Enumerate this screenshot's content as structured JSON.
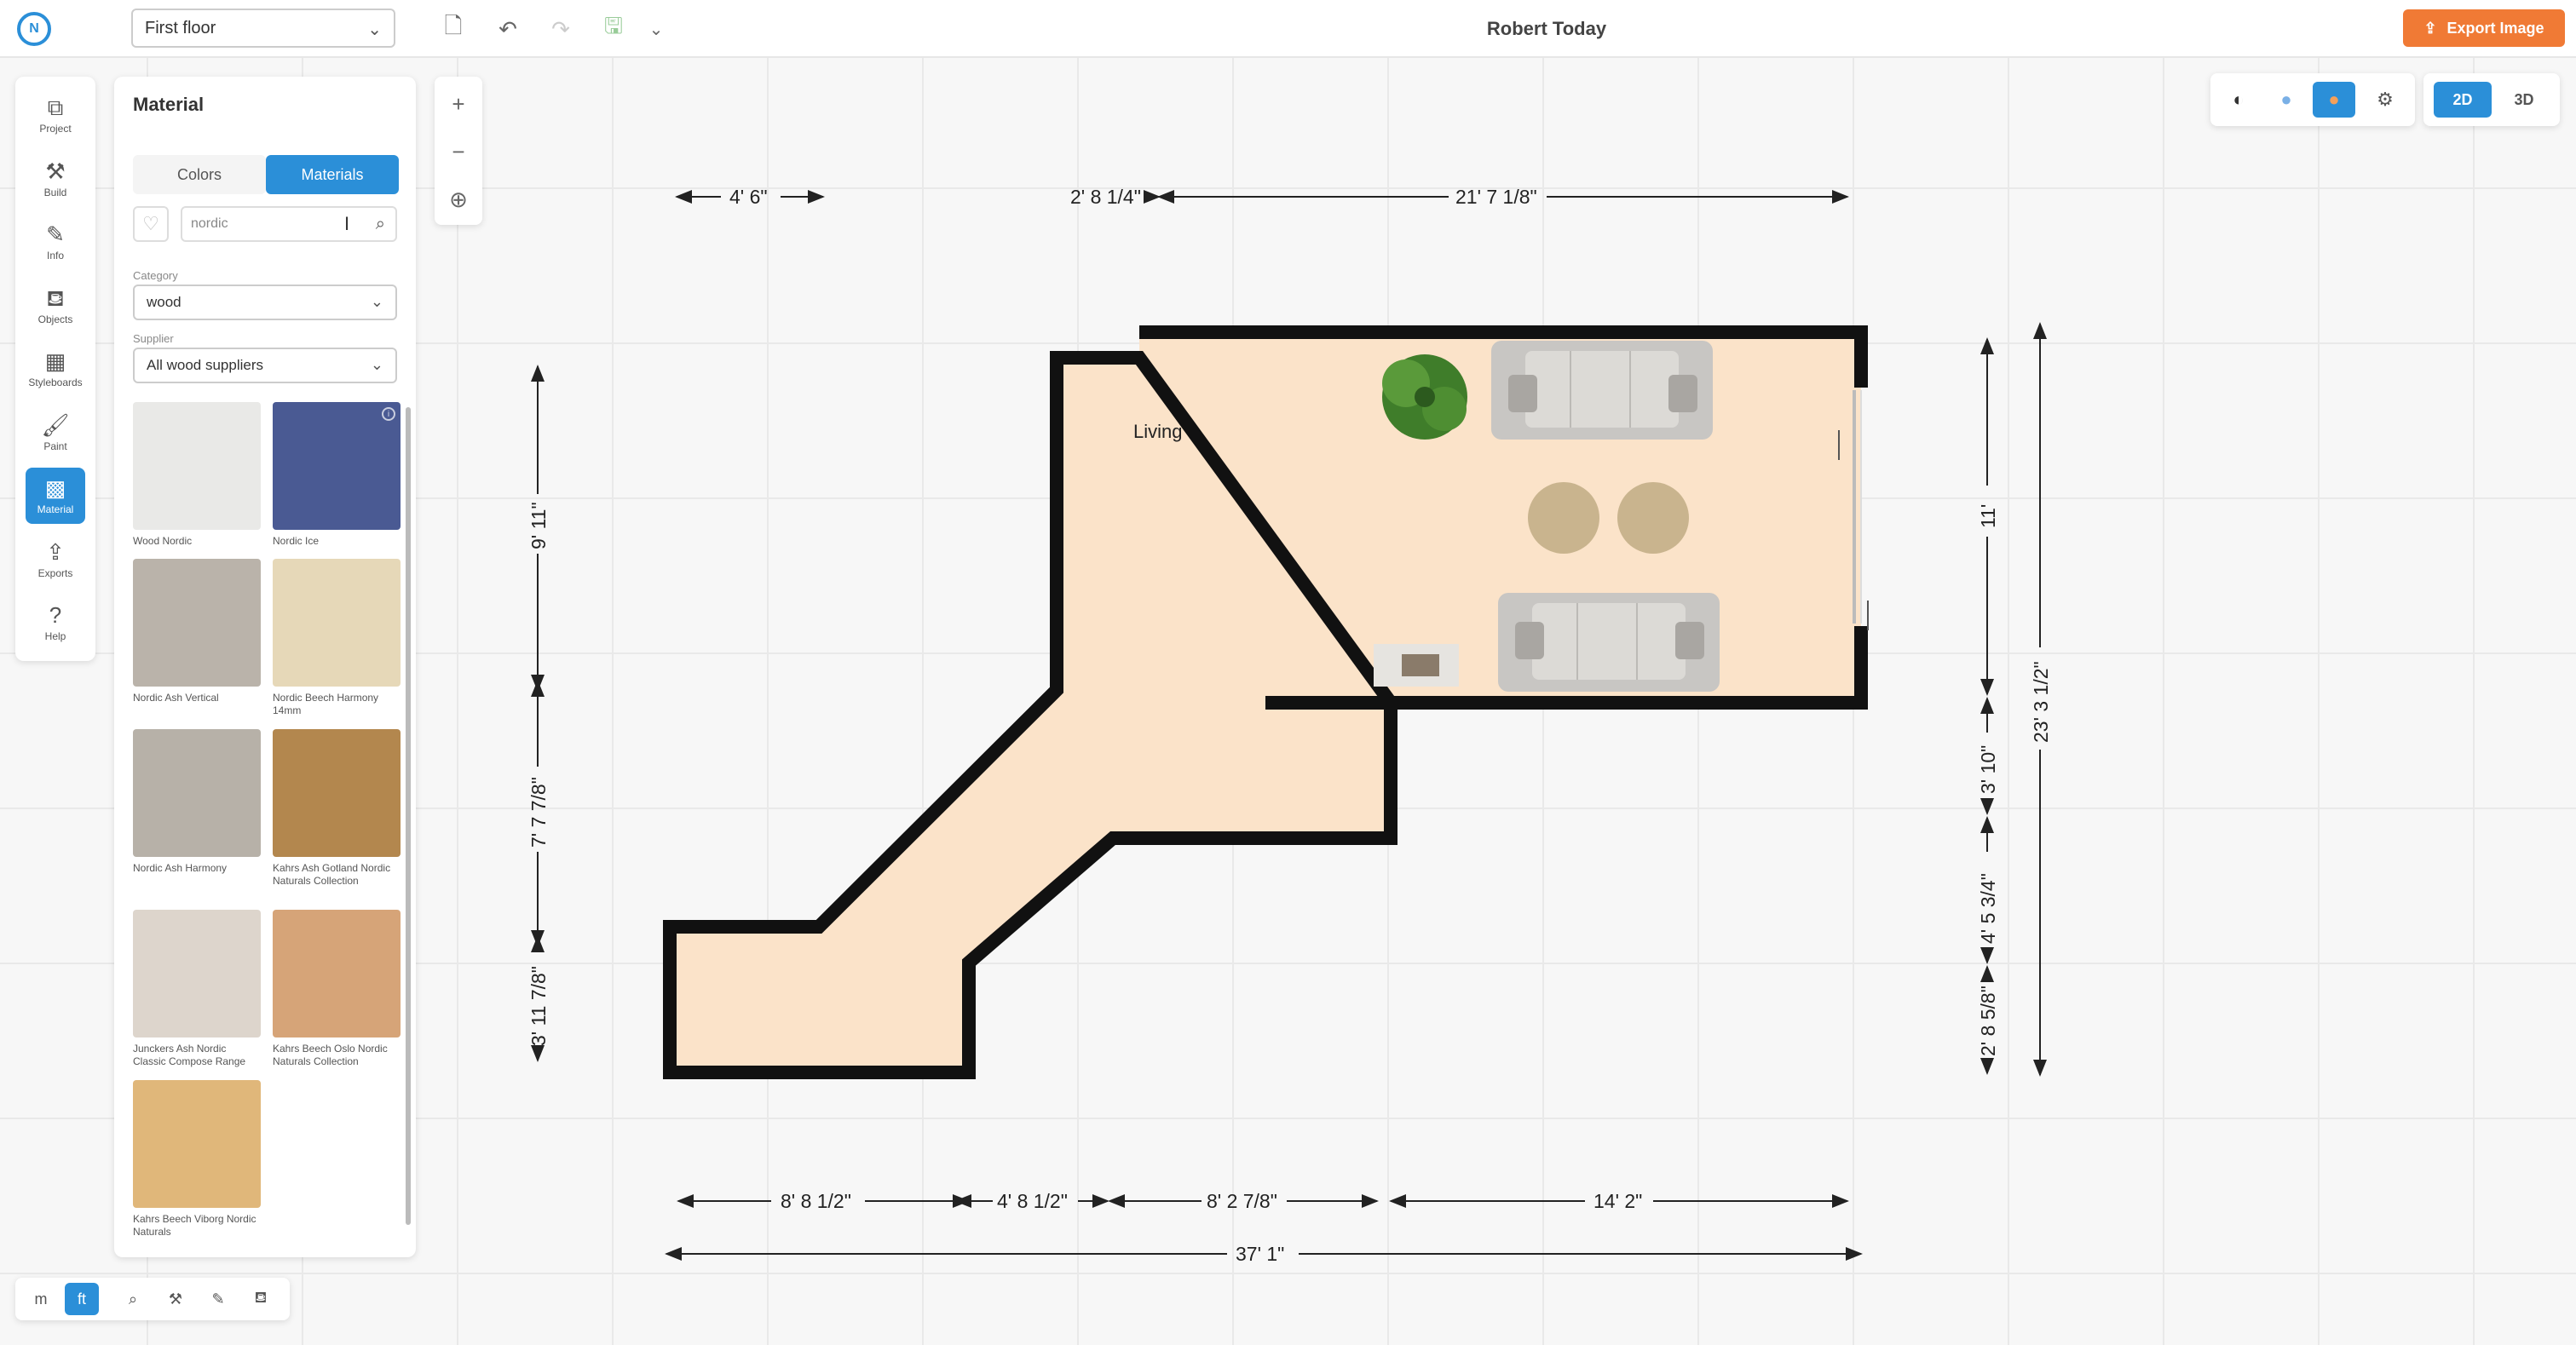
{
  "topbar": {
    "logo": "N",
    "floor": "First floor",
    "title": "Robert Today",
    "export_label": "Export Image"
  },
  "sidebar": {
    "items": [
      {
        "label": "Project",
        "icon": "project-icon",
        "glyph": "⧉"
      },
      {
        "label": "Build",
        "icon": "build-icon",
        "glyph": "⚒"
      },
      {
        "label": "Info",
        "icon": "info-icon",
        "glyph": "✎"
      },
      {
        "label": "Objects",
        "icon": "sofa-icon",
        "glyph": "⛾"
      },
      {
        "label": "Styleboards",
        "icon": "styleboards-icon",
        "glyph": "▦"
      },
      {
        "label": "Paint",
        "icon": "paint-roller-icon",
        "glyph": "🖌"
      },
      {
        "label": "Material",
        "icon": "material-icon",
        "glyph": "▩",
        "active": true
      },
      {
        "label": "Exports",
        "icon": "exports-icon",
        "glyph": "⇪"
      },
      {
        "label": "Help",
        "icon": "help-icon",
        "glyph": "?"
      }
    ]
  },
  "panel": {
    "title": "Material",
    "tab_colors": "Colors",
    "tab_materials": "Materials",
    "search_value": "nordic",
    "category_label": "Category",
    "category_value": "wood",
    "supplier_label": "Supplier",
    "supplier_value": "All wood suppliers",
    "materials": [
      {
        "name": "Wood Nordic",
        "color": "#e9e9e7"
      },
      {
        "name": "Nordic Ice",
        "color": "#4a5a93"
      },
      {
        "name": "Nordic Ash Vertical",
        "color": "#bab3aa"
      },
      {
        "name": "Nordic Beech Harmony 14mm",
        "color": "#e6d8b8"
      },
      {
        "name": "Nordic Ash Harmony",
        "color": "#b7b1a8"
      },
      {
        "name": "Kahrs Ash Gotland Nordic Naturals Collection",
        "color": "#b3874e"
      },
      {
        "name": "Junckers Ash Nordic Classic Compose Range",
        "color": "#ddd5cc"
      },
      {
        "name": "Kahrs Beech Oslo Nordic Naturals Collection",
        "color": "#d6a478"
      },
      {
        "name": "Kahrs Beech Viborg Nordic Naturals",
        "color": "#e0b77a"
      }
    ]
  },
  "bottom_toolbar": {
    "unit_m": "m",
    "unit_ft": "ft"
  },
  "view": {
    "mode_2d": "2D",
    "mode_3d": "3D"
  },
  "floorplan": {
    "room_label": "Living",
    "dims": {
      "top_left": "4' 6\"",
      "top_mid": "2' 8 1/4\"",
      "top_right": "21' 7 1/8\"",
      "left_1": "9' 11\"",
      "left_2": "7' 7 7/8\"",
      "left_3": "3' 11 7/8\"",
      "right_1": "11'",
      "right_2": "3' 10\"",
      "right_3": "4' 5 3/4\"",
      "right_4": "2' 8 5/8\"",
      "right_total": "23' 3 1/2\"",
      "bottom_1": "8' 8 1/2\"",
      "bottom_2": "4' 8 1/2\"",
      "bottom_3": "8' 2 7/8\"",
      "bottom_4": "14' 2\"",
      "bottom_total": "37' 1\""
    }
  }
}
